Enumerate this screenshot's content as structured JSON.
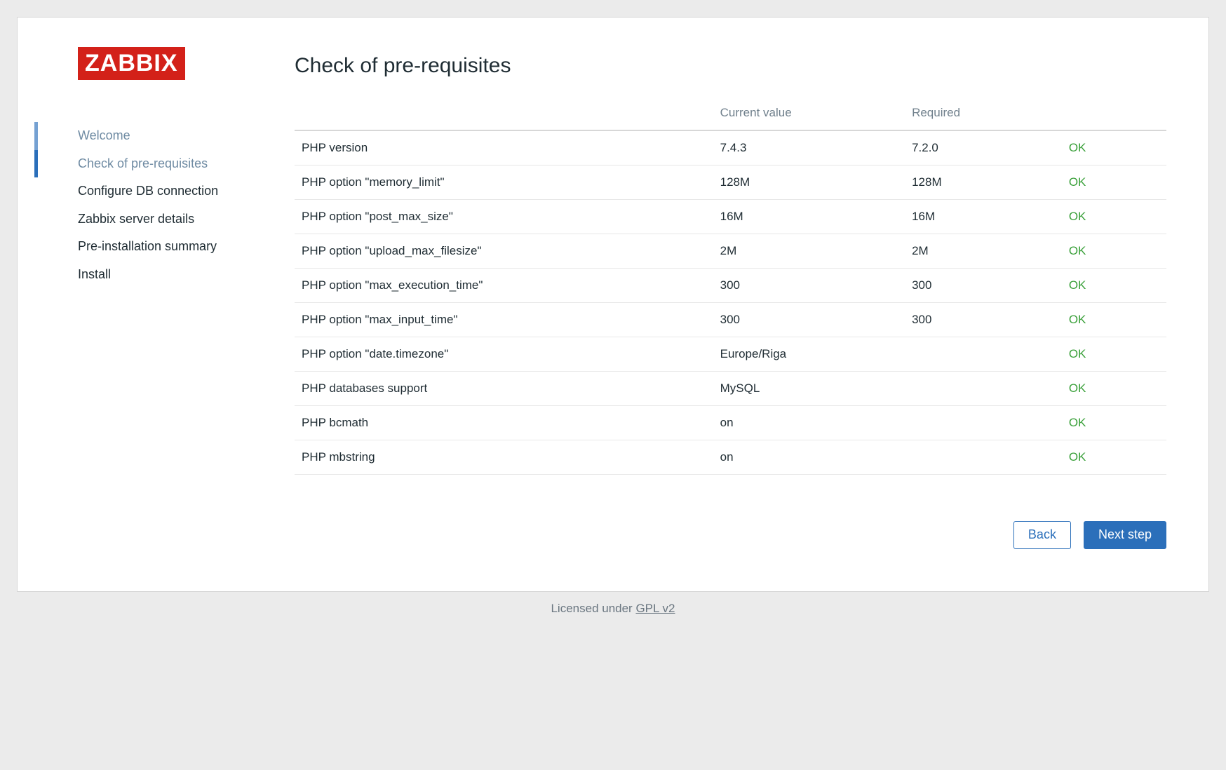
{
  "logo_text": "ZABBIX",
  "page_title": "Check of pre-requisites",
  "steps": [
    {
      "label": "Welcome",
      "state": "done"
    },
    {
      "label": "Check of pre-requisites",
      "state": "current"
    },
    {
      "label": "Configure DB connection",
      "state": "todo"
    },
    {
      "label": "Zabbix server details",
      "state": "todo"
    },
    {
      "label": "Pre-installation summary",
      "state": "todo"
    },
    {
      "label": "Install",
      "state": "todo"
    }
  ],
  "table": {
    "headers": {
      "name": "",
      "current": "Current value",
      "required": "Required",
      "status": ""
    },
    "rows": [
      {
        "name": "PHP version",
        "current": "7.4.3",
        "required": "7.2.0",
        "status": "OK"
      },
      {
        "name": "PHP option \"memory_limit\"",
        "current": "128M",
        "required": "128M",
        "status": "OK"
      },
      {
        "name": "PHP option \"post_max_size\"",
        "current": "16M",
        "required": "16M",
        "status": "OK"
      },
      {
        "name": "PHP option \"upload_max_filesize\"",
        "current": "2M",
        "required": "2M",
        "status": "OK"
      },
      {
        "name": "PHP option \"max_execution_time\"",
        "current": "300",
        "required": "300",
        "status": "OK"
      },
      {
        "name": "PHP option \"max_input_time\"",
        "current": "300",
        "required": "300",
        "status": "OK"
      },
      {
        "name": "PHP option \"date.timezone\"",
        "current": "Europe/Riga",
        "required": "",
        "status": "OK"
      },
      {
        "name": "PHP databases support",
        "current": "MySQL",
        "required": "",
        "status": "OK"
      },
      {
        "name": "PHP bcmath",
        "current": "on",
        "required": "",
        "status": "OK"
      },
      {
        "name": "PHP mbstring",
        "current": "on",
        "required": "",
        "status": "OK"
      }
    ]
  },
  "buttons": {
    "back": "Back",
    "next": "Next step"
  },
  "license": {
    "prefix": "Licensed under ",
    "link": "GPL v2"
  }
}
